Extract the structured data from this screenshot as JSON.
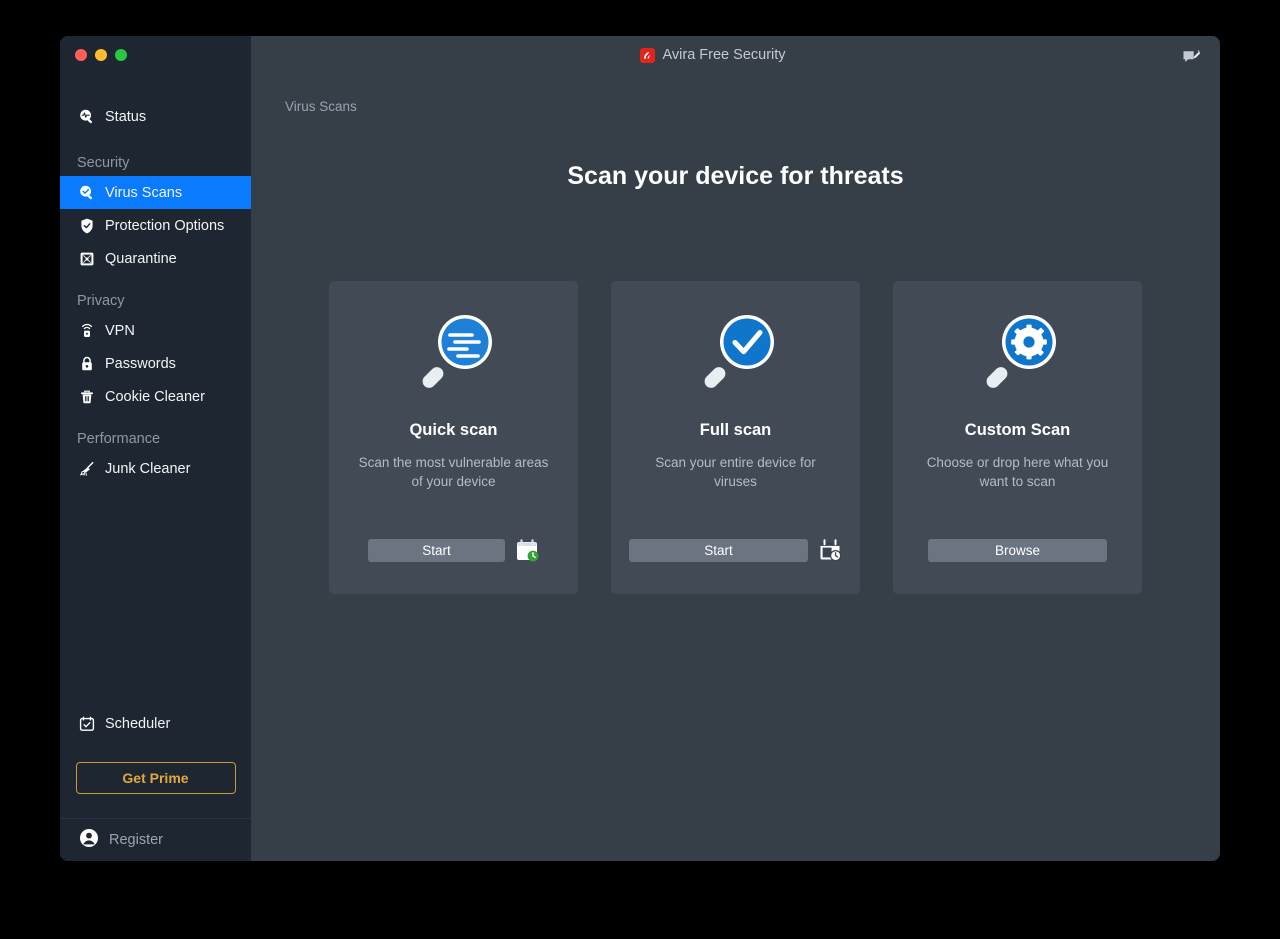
{
  "window": {
    "app_title": "Avira Free Security",
    "logo_icon": "avira-logo-icon",
    "traffic_lights": [
      "close",
      "minimize",
      "zoom"
    ],
    "feedback_icon": "feedback-pencil-icon"
  },
  "sidebar": {
    "status": {
      "label": "Status",
      "icon": "magnifier-pulse-icon"
    },
    "groups": [
      {
        "title": "Security",
        "items": [
          {
            "label": "Virus Scans",
            "icon": "magnifier-check-icon",
            "active": true
          },
          {
            "label": "Protection Options",
            "icon": "shield-check-icon",
            "active": false
          },
          {
            "label": "Quarantine",
            "icon": "quarantine-box-icon",
            "active": false
          }
        ]
      },
      {
        "title": "Privacy",
        "items": [
          {
            "label": "VPN",
            "icon": "vpn-signal-lock-icon",
            "active": false
          },
          {
            "label": "Passwords",
            "icon": "lock-icon",
            "active": false
          },
          {
            "label": "Cookie Cleaner",
            "icon": "trash-icon",
            "active": false
          }
        ]
      },
      {
        "title": "Performance",
        "items": [
          {
            "label": "Junk Cleaner",
            "icon": "broom-icon",
            "active": false
          }
        ]
      }
    ],
    "scheduler": {
      "label": "Scheduler",
      "icon": "calendar-check-icon"
    },
    "get_prime_label": "Get Prime",
    "register": {
      "label": "Register",
      "icon": "user-avatar-icon"
    }
  },
  "main": {
    "breadcrumb": "Virus Scans",
    "page_title": "Scan your device for threats",
    "cards": [
      {
        "title": "Quick scan",
        "description": "Scan the most vulnerable areas of your device",
        "icon": "magnifier-lines-icon",
        "button_label": "Start",
        "schedule_icon": "calendar-clock-green-icon",
        "has_schedule": true
      },
      {
        "title": "Full scan",
        "description": "Scan your entire device for viruses",
        "icon": "magnifier-check-icon",
        "button_label": "Start",
        "schedule_icon": "calendar-clock-icon",
        "has_schedule": true
      },
      {
        "title": "Custom Scan",
        "description": "Choose or drop here what you want to scan",
        "icon": "magnifier-gear-icon",
        "button_label": "Browse",
        "schedule_icon": "",
        "has_schedule": false
      }
    ]
  },
  "colors": {
    "accent_blue": "#0a7aff",
    "icon_blue": "#1f81d6",
    "prime_gold": "#e0a93c",
    "sidebar_bg": "#1e2631",
    "main_bg": "#363e48",
    "card_bg": "#414a55",
    "button_grey": "#6b7481",
    "green_badge": "#35a335"
  }
}
